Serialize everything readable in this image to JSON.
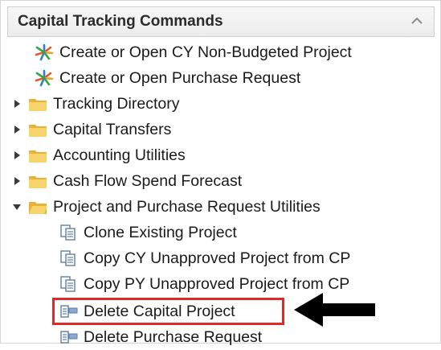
{
  "panel": {
    "title": "Capital Tracking Commands",
    "collapse_icon": "chevron-up-icon"
  },
  "tree": [
    {
      "label": "Create or Open CY Non-Budgeted Project",
      "icon": "star-burst-icon",
      "level": 1
    },
    {
      "label": "Create or Open Purchase Request",
      "icon": "star-burst-icon",
      "level": 1
    },
    {
      "label": "Tracking Directory",
      "icon": "folder-icon",
      "expanded": false
    },
    {
      "label": "Capital Transfers",
      "icon": "folder-icon",
      "expanded": false
    },
    {
      "label": "Accounting Utilities",
      "icon": "folder-icon",
      "expanded": false
    },
    {
      "label": "Cash Flow Spend Forecast",
      "icon": "folder-icon",
      "expanded": false
    },
    {
      "label": "Project and Purchase Request Utilities",
      "icon": "folder-open-icon",
      "expanded": true
    },
    {
      "label": "Clone Existing Project",
      "icon": "document-copy-icon"
    },
    {
      "label": "Copy CY Unapproved Project from CP",
      "icon": "document-copy-icon"
    },
    {
      "label": "Copy PY Unapproved Project from CP",
      "icon": "document-copy-icon"
    },
    {
      "label": "Delete Capital Project",
      "icon": "delete-record-icon",
      "highlighted": true
    },
    {
      "label": "Delete Purchase Request",
      "icon": "delete-record-icon"
    }
  ],
  "colors": {
    "highlight_border": "#e02a2a",
    "arrow": "#000000",
    "folder": "#f2c14e"
  }
}
